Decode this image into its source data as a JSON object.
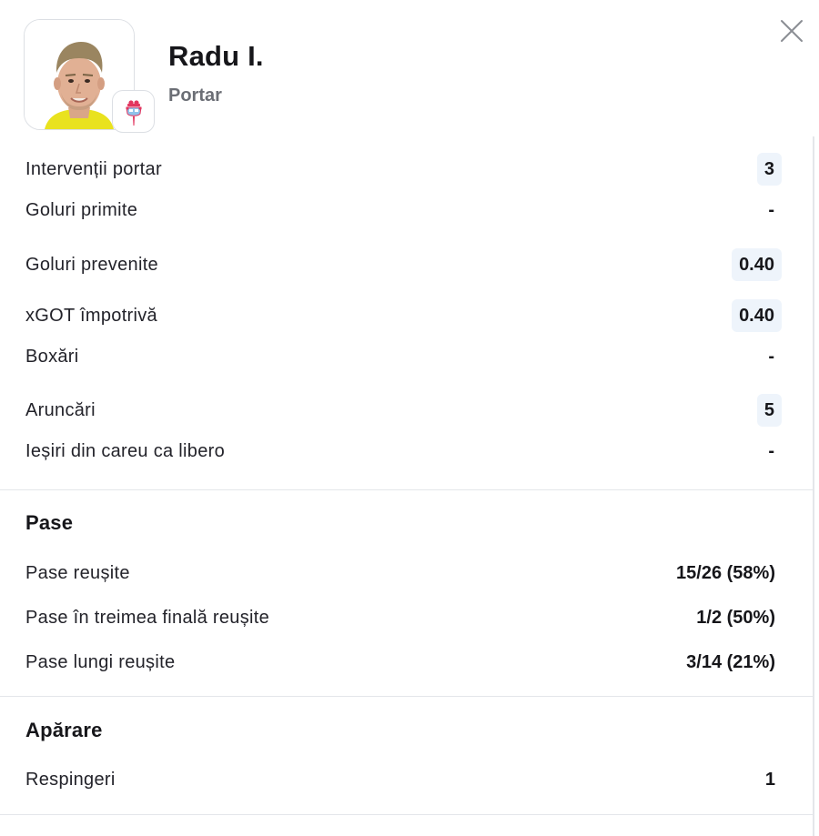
{
  "player": {
    "name": "Radu I.",
    "position": "Portar"
  },
  "goalkeeping": [
    {
      "label": "Intervenții portar",
      "value": "3",
      "highlighted": true
    },
    {
      "label": "Goluri primite",
      "value": "-",
      "highlighted": false
    },
    {
      "label": "Goluri prevenite",
      "value": "0.40",
      "highlighted": true
    },
    {
      "label": "xGOT împotrivă",
      "value": "0.40",
      "highlighted": true
    },
    {
      "label": "Boxări",
      "value": "-",
      "highlighted": false
    },
    {
      "label": "Aruncări",
      "value": "5",
      "highlighted": true
    },
    {
      "label": "Ieșiri din careu ca libero",
      "value": "-",
      "highlighted": false
    }
  ],
  "passing": {
    "title": "Pase",
    "rows": [
      {
        "label": "Pase reușite",
        "value": "15/26 (58%)"
      },
      {
        "label": "Pase în treimea finală reușite",
        "value": "1/2 (50%)"
      },
      {
        "label": "Pase lungi reușite",
        "value": "3/14 (21%)"
      }
    ]
  },
  "defending": {
    "title": "Apărare",
    "rows": [
      {
        "label": "Respingeri",
        "value": "1"
      }
    ]
  },
  "colors": {
    "highlight_bg": "#eef4fb",
    "divider": "#e4e6ea",
    "club_accent": "#e2365f",
    "club_blue": "#8fc3ea"
  },
  "icons": {
    "close": "close-icon",
    "club": "club-crest-icon",
    "avatar": "player-photo"
  }
}
